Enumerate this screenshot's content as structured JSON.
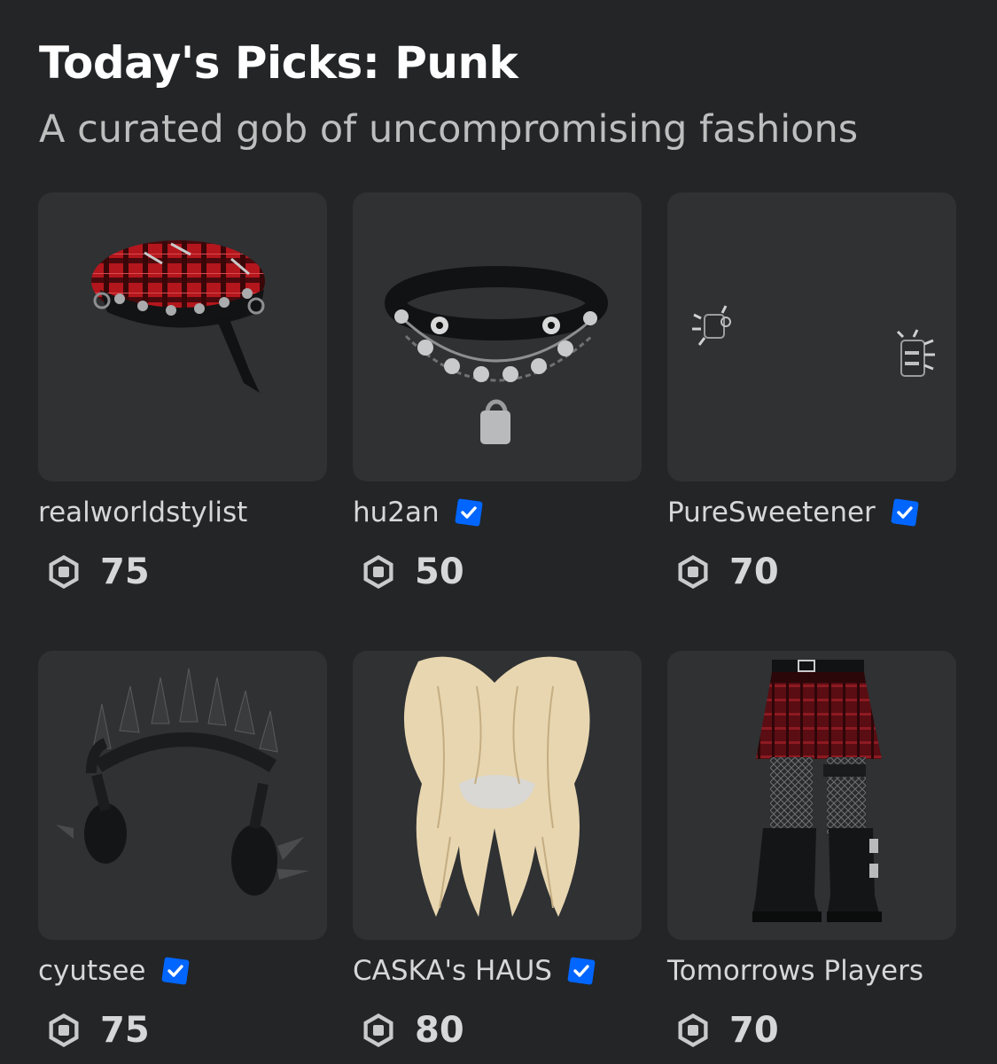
{
  "header": {
    "title": "Today's Picks: Punk",
    "subtitle": "A curated gob of uncompromising fashions"
  },
  "items": [
    {
      "creator": "realworldstylist",
      "verified": false,
      "price": "75",
      "image": "red plaid studded beret"
    },
    {
      "creator": "hu2an",
      "verified": true,
      "price": "50",
      "image": "studded choker with padlock chain"
    },
    {
      "creator": "PureSweetener",
      "verified": true,
      "price": "70",
      "image": "spiked wrist cuffs"
    },
    {
      "creator": "cyutsee",
      "verified": true,
      "price": "75",
      "image": "spiked crown headphones"
    },
    {
      "creator": "CASKA's HAUS",
      "verified": true,
      "price": "80",
      "image": "blonde wavy hair"
    },
    {
      "creator": "Tomorrows Players",
      "verified": false,
      "price": "70",
      "image": "red plaid skirt with fishnets and boots"
    }
  ],
  "icons": {
    "verified": "verified-badge-icon",
    "currency": "robux-icon"
  },
  "colors": {
    "background": "#232527",
    "card": "#2f3133",
    "verified": "#0066ff",
    "text_secondary": "#bdbebe"
  }
}
